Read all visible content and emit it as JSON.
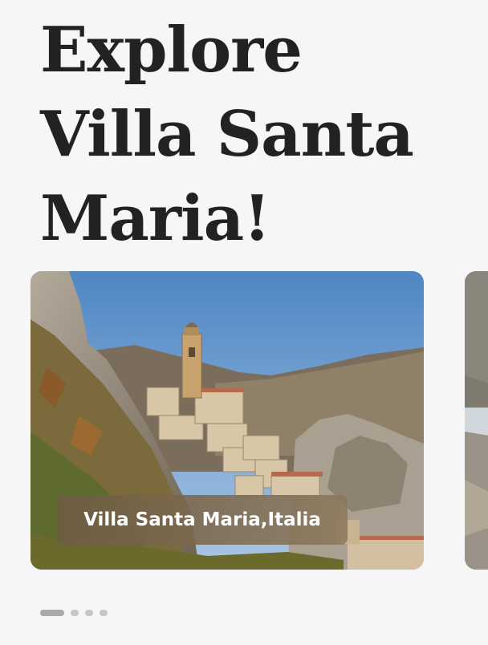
{
  "header": {
    "title_lines": [
      "Explore",
      "Villa Santa",
      "Maria!"
    ]
  },
  "carousel": {
    "cards": [
      {
        "caption": "Villa Santa Maria,Italia",
        "image": "hillside-village-bell-tower"
      },
      {
        "caption": "",
        "image": "rocky-waterfall"
      }
    ],
    "pagination": {
      "count": 4,
      "active": 0
    }
  },
  "colors": {
    "background": "#f6f6f6",
    "title": "#222222",
    "caption_bg": "#7a6a52",
    "caption_text": "#ffffff",
    "dot_active": "#a9a9a9",
    "dot_inactive": "#c7c7c7"
  }
}
